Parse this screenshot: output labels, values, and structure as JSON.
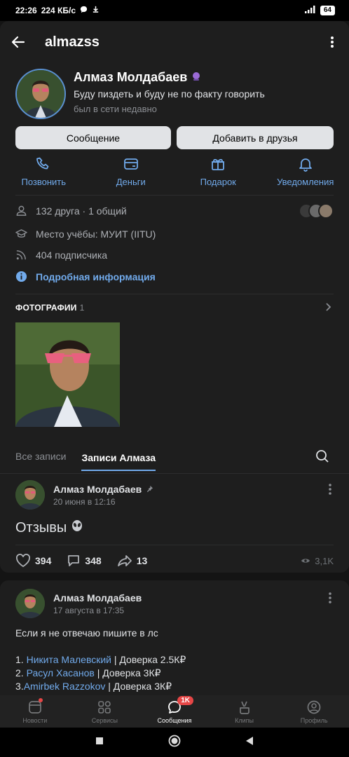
{
  "status_bar": {
    "time": "22:26",
    "speed": "224 КБ/с",
    "battery": "64"
  },
  "header": {
    "title": "almazss"
  },
  "profile": {
    "name": "Алмаз Молдабаев",
    "status": "Буду пиздеть и буду не по факту говорить",
    "last_seen": "был в сети недавно",
    "message_button": "Сообщение",
    "add_friend_button": "Добавить в друзья"
  },
  "actions": [
    {
      "label": "Позвонить",
      "icon": "phone-icon"
    },
    {
      "label": "Деньги",
      "icon": "money-icon"
    },
    {
      "label": "Подарок",
      "icon": "gift-icon"
    },
    {
      "label": "Уведомления",
      "icon": "bell-icon"
    }
  ],
  "info": {
    "friends": "132 друга · 1 общий",
    "education": "Место учёбы: МУИТ (IITU)",
    "followers": "404 подписчика",
    "details_link": "Подробная информация"
  },
  "photos": {
    "title": "ФОТОГРАФИИ",
    "count": "1"
  },
  "feed": {
    "tab_all": "Все записи",
    "tab_own": "Записи Алмаза"
  },
  "post1": {
    "author": "Алмаз Молдабаев",
    "date": "20 июня в 12:16",
    "text": "Отзывы",
    "likes": "394",
    "comments": "348",
    "shares": "13",
    "views": "3,1K"
  },
  "post2": {
    "author": "Алмаз Молдабаев",
    "date": "17 августа в 17:35",
    "line1": "Если я не отвечаю пишите в лс",
    "items": [
      {
        "prefix": "1. ",
        "link": "Никита Малевский",
        "suffix": " | Доверка 2.5К₽"
      },
      {
        "prefix": "2. ",
        "link": "Расул Хасанов",
        "suffix": " | Доверка 3К₽"
      },
      {
        "prefix": "3.",
        "link": "Amirbek Razzokov ",
        "suffix": " | Доверка 3К₽"
      }
    ]
  },
  "tabbar": {
    "items": [
      {
        "label": "Новости"
      },
      {
        "label": "Сервисы"
      },
      {
        "label": "Сообщения",
        "badge": "1K"
      },
      {
        "label": "Клипы"
      },
      {
        "label": "Профиль"
      }
    ]
  },
  "colors": {
    "accent": "#71aaeb",
    "background": "#141414",
    "card": "#1e1e1e",
    "badge": "#e64646"
  }
}
